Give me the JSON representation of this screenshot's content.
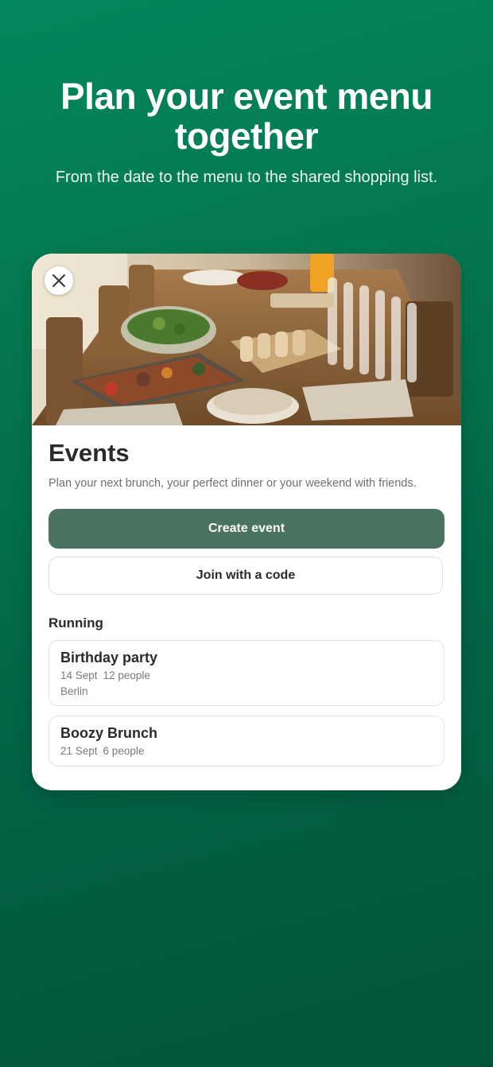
{
  "hero": {
    "title": "Plan your event menu together",
    "subtitle": "From the date to the menu to the shared shopping list."
  },
  "card": {
    "close_icon": "close-icon",
    "section_title": "Events",
    "description": "Plan your next brunch, your perfect dinner or your weekend with friends.",
    "create_button_label": "Create event",
    "join_button_label": "Join with a code",
    "running_label": "Running",
    "events": [
      {
        "name": "Birthday party",
        "date": "14 Sept",
        "people": "12 people",
        "location": "Berlin"
      },
      {
        "name": "Boozy Brunch",
        "date": "21 Sept",
        "people": "6 people"
      }
    ]
  },
  "colors": {
    "background_gradient_top": "#03875e",
    "background_gradient_bottom": "#02553a",
    "primary_button": "#4a7461",
    "card_background": "#ffffff"
  }
}
